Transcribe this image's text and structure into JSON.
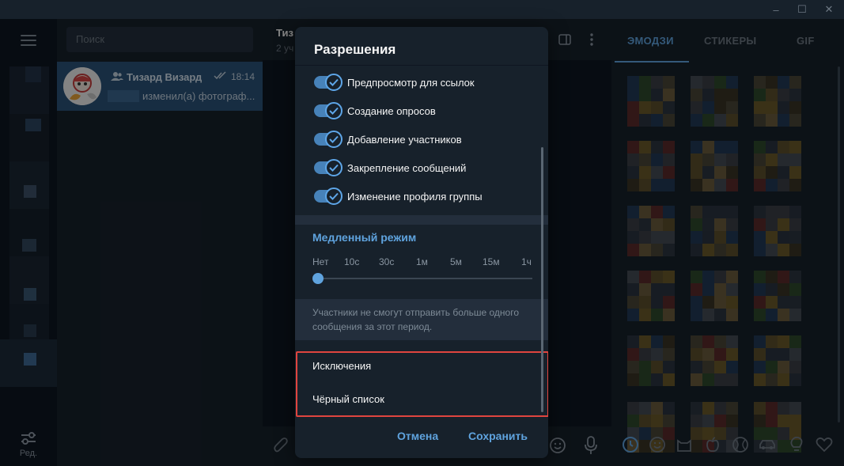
{
  "window": {
    "controls": [
      "–",
      "☐",
      "✕"
    ]
  },
  "sidebar": {
    "menu_icon": "hamburger-icon",
    "edit_label": "Ред."
  },
  "chat_list": {
    "search_placeholder": "Поиск",
    "chats": [
      {
        "name": "Тизард Визард",
        "time": "18:14",
        "preview": "изменил(а) фотограф..."
      }
    ]
  },
  "chat": {
    "title": "Тиз",
    "subtitle": "2 уч"
  },
  "emoji_panel": {
    "tabs": [
      "ЭМОДЗИ",
      "СТИКЕРЫ",
      "GIF"
    ],
    "active_tab": "ЭМОДЗИ"
  },
  "dialog": {
    "title": "Разрешения",
    "permissions": [
      {
        "label": "Предпросмотр для ссылок",
        "enabled": true
      },
      {
        "label": "Создание опросов",
        "enabled": true
      },
      {
        "label": "Добавление участников",
        "enabled": true
      },
      {
        "label": "Закрепление сообщений",
        "enabled": true
      },
      {
        "label": "Изменение профиля группы",
        "enabled": true
      }
    ],
    "slow_mode": {
      "title": "Медленный режим",
      "options": [
        "Нет",
        "10с",
        "30с",
        "1м",
        "5м",
        "15м",
        "1ч"
      ],
      "selected": "Нет",
      "note": "Участники не смогут отправить больше одного сообщения за этот период."
    },
    "exceptions_label": "Исключения",
    "blacklist_label": "Чёрный список",
    "cancel_label": "Отмена",
    "save_label": "Сохранить"
  },
  "colors": {
    "accent": "#5fa3de",
    "highlight_border": "#e0453f",
    "background": "#0e1621",
    "panel": "#17212b"
  }
}
